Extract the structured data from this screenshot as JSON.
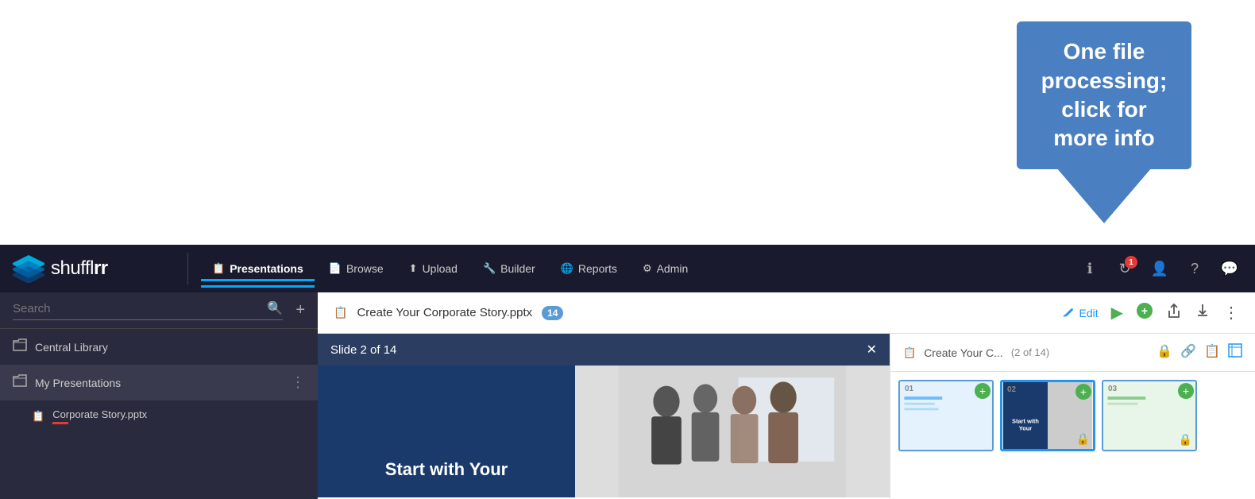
{
  "tooltip": {
    "text": "One file processing; click for more info"
  },
  "navbar": {
    "logo_text_start": "shuffl",
    "logo_text_end": "rr",
    "nav_items": [
      {
        "id": "presentations",
        "label": "Presentations",
        "icon": "🗒",
        "active": true
      },
      {
        "id": "browse",
        "label": "Browse",
        "icon": "📄"
      },
      {
        "id": "upload",
        "label": "Upload",
        "icon": "⬆"
      },
      {
        "id": "builder",
        "label": "Builder",
        "icon": "🔧"
      },
      {
        "id": "reports",
        "label": "Reports",
        "icon": "🌐"
      },
      {
        "id": "admin",
        "label": "Admin",
        "icon": "⚙"
      }
    ],
    "badge_count": "1"
  },
  "sidebar": {
    "search_placeholder": "Search",
    "items": [
      {
        "id": "central-library",
        "label": "Central Library",
        "icon": "folder"
      },
      {
        "id": "my-presentations",
        "label": "My Presentations",
        "icon": "folder",
        "has_more": true
      }
    ],
    "files": [
      {
        "id": "corporate-story",
        "label": "Corporate Story.pptx",
        "has_indicator": true
      }
    ]
  },
  "file_header": {
    "title": "Create Your Corporate Story.pptx",
    "slide_count": "14",
    "edit_label": "Edit",
    "actions": [
      "play",
      "add",
      "share",
      "download",
      "more"
    ]
  },
  "slide_viewer": {
    "title": "Slide 2 of 14",
    "slide_text": "Start with Your"
  },
  "thumb_panel": {
    "title": "Create Your C...",
    "count": "(2 of 14)",
    "slides": [
      {
        "num": "01"
      },
      {
        "num": "02",
        "active": true
      },
      {
        "num": "03"
      }
    ]
  }
}
